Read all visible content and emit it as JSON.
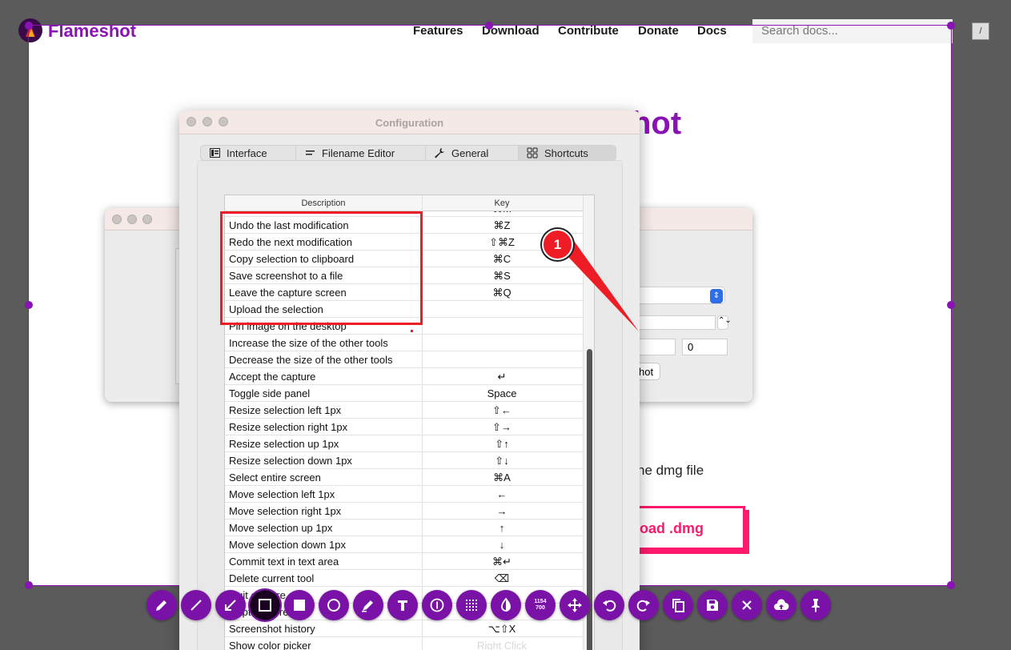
{
  "website": {
    "brand": "Flameshot",
    "nav": [
      "Features",
      "Download",
      "Contribute",
      "Donate",
      "Docs"
    ],
    "search_placeholder": "Search docs...",
    "search_shortcut": "/",
    "heading_fragment": "hot",
    "dmg_text_fragment": "he dmg file",
    "download_button_fragment": "oad .dmg"
  },
  "back_window": {
    "field_value": "0",
    "button_fragment": "hot"
  },
  "config_window": {
    "title": "Configuration",
    "tabs": [
      {
        "label": "Interface",
        "icon": "interface-icon"
      },
      {
        "label": "Filename Editor",
        "icon": "filename-editor-icon"
      },
      {
        "label": "General",
        "icon": "wrench-icon"
      },
      {
        "label": "Shortcuts",
        "icon": "grid-icon"
      }
    ],
    "active_tab": "Shortcuts",
    "table": {
      "headers": {
        "description": "Description",
        "key": "Key"
      },
      "rows": [
        {
          "desc": "Move the selection area",
          "key": "⌘M"
        },
        {
          "desc": "Undo the last modification",
          "key": "⌘Z"
        },
        {
          "desc": "Redo the next modification",
          "key": "⇧⌘Z"
        },
        {
          "desc": "Copy selection to clipboard",
          "key": "⌘C"
        },
        {
          "desc": "Save screenshot to a file",
          "key": "⌘S"
        },
        {
          "desc": "Leave the capture screen",
          "key": "⌘Q"
        },
        {
          "desc": "Upload the selection",
          "key": ""
        },
        {
          "desc": "Pin image on the desktop",
          "key": ""
        },
        {
          "desc": "Increase the size of the other tools",
          "key": ""
        },
        {
          "desc": "Decrease the size of the other tools",
          "key": ""
        },
        {
          "desc": "Accept the capture",
          "key": "↵"
        },
        {
          "desc": "Toggle side panel",
          "key": "Space"
        },
        {
          "desc": "Resize selection left 1px",
          "key": "⇧←"
        },
        {
          "desc": "Resize selection right 1px",
          "key": "⇧→"
        },
        {
          "desc": "Resize selection up 1px",
          "key": "⇧↑"
        },
        {
          "desc": "Resize selection down 1px",
          "key": "⇧↓"
        },
        {
          "desc": "Select entire screen",
          "key": "⌘A"
        },
        {
          "desc": "Move selection left 1px",
          "key": "←"
        },
        {
          "desc": "Move selection right 1px",
          "key": "→"
        },
        {
          "desc": "Move selection up 1px",
          "key": "↑"
        },
        {
          "desc": "Move selection down 1px",
          "key": "↓"
        },
        {
          "desc": "Commit text in text area",
          "key": "⌘↵"
        },
        {
          "desc": "Delete current tool",
          "key": "⌫"
        },
        {
          "desc": "Quit capture",
          "key": ""
        },
        {
          "desc": "Capture screen",
          "key": "⇧"
        },
        {
          "desc": "Screenshot history",
          "key": "⌥⇧X"
        },
        {
          "desc": "Show color picker",
          "key": "Right Click"
        }
      ]
    }
  },
  "annotation": {
    "marker_number": "1",
    "color": "#ee1c25"
  },
  "toolbar": {
    "size_indicator": [
      "1154",
      "700"
    ],
    "tools": [
      "pencil",
      "line",
      "arrow",
      "selection",
      "rectangle",
      "circle",
      "marker",
      "text",
      "circle-counter",
      "pixelate",
      "invert",
      "selection-size",
      "move",
      "undo",
      "redo",
      "copy",
      "save",
      "exit",
      "upload",
      "pin"
    ],
    "active_tool": "selection",
    "accent": "#7b12a8"
  },
  "colors": {
    "brand": "#8a13b3",
    "download_accent": "#ff1a6b",
    "overlay": "#5b5b5b"
  }
}
